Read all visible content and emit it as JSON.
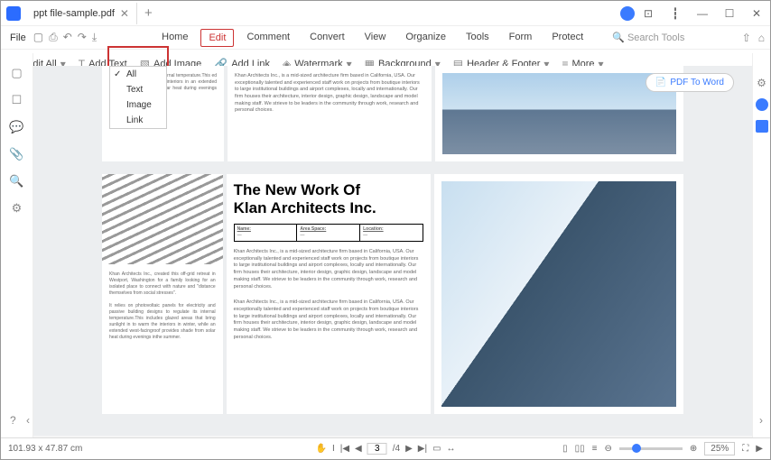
{
  "title": "ppt file-sample.pdf",
  "file_menu": "File",
  "tabs": {
    "home": "Home",
    "edit": "Edit",
    "comment": "Comment",
    "convert": "Convert",
    "view": "View",
    "organize": "Organize",
    "tools": "Tools",
    "form": "Form",
    "protect": "Protect"
  },
  "search": "Search Tools",
  "toolbar": {
    "edit_all": "Edit All",
    "add_text": "Add Text",
    "add_image": "Add Image",
    "add_link": "Add Link",
    "watermark": "Watermark",
    "background": "Background",
    "header_footer": "Header & Footer",
    "more": "More"
  },
  "dropdown": {
    "all": "All",
    "text": "Text",
    "image": "Image",
    "link": "Link"
  },
  "pdf_to_word": "PDF To Word",
  "heading1": "The New Work Of",
  "heading2": "Klan Architects Inc.",
  "info": {
    "name": "Name:",
    "area": "Area Space:",
    "location": "Location:"
  },
  "body1": "Khan Architects Inc., is a mid-sized architecture firm based in California, USA. Our exceptionally talented and experienced staff work on projects from boutique interiors to large institutional buildings and airport complexes, locally and internationally. Our firm houses their architecture, interior design, graphic design, landscape and model making staff. We strieve to be leaders in the community through work, research and personal choices.",
  "left1": "passive building designs internal temperature.This ed areas that bring warm the interiors in an extended west- vides shade from solar heat during evenings inthe summer.",
  "left2a": "Khan Architects Inc., created this off-grid retreat in Westport, Washington for a family looking for an isolated place to connect with nature and \"distance themselves from social stresses\".",
  "left2b": "It relies on photovoltaic panels for electricity and passive building designs to regulate its internal temperature.This includes glazed areas that bring sunlight in to warm the interiors in winter, while an extended west-facingroof provides shade from solar heat during evenings inthe summer.",
  "status": {
    "dim": "101.93 x 47.87 cm",
    "page": "3",
    "total": "/4",
    "zoom": "25%"
  }
}
